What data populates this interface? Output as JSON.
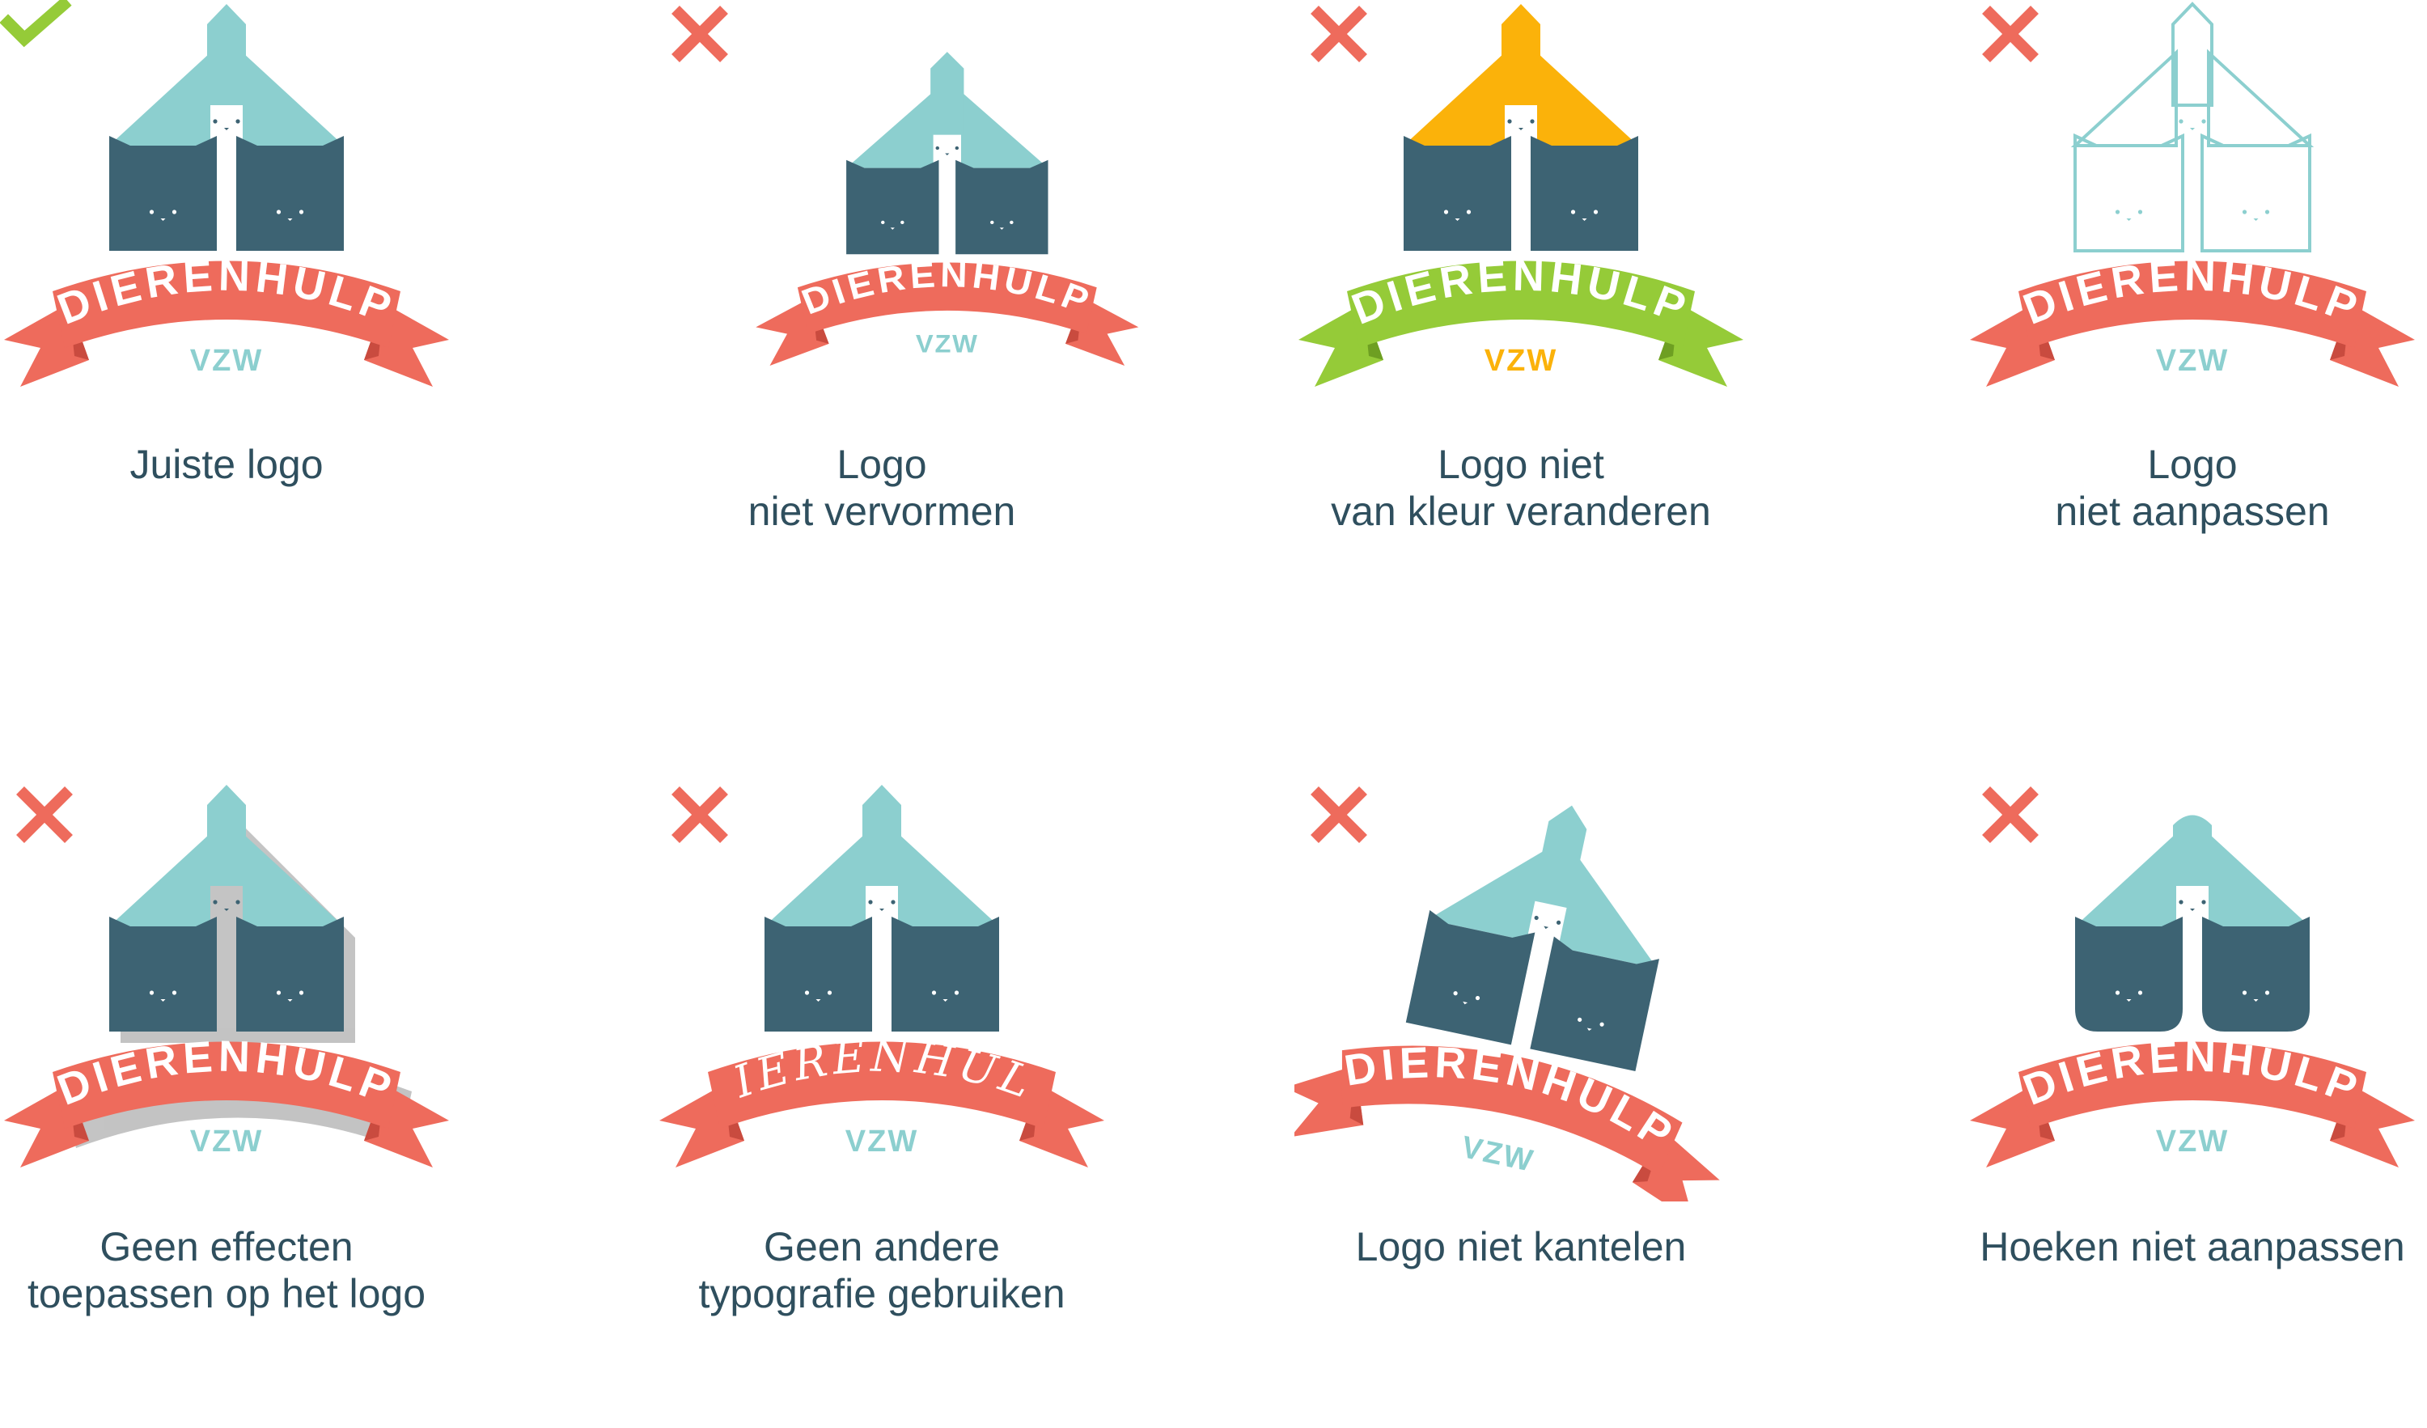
{
  "brand": {
    "name": "DIERENHULP",
    "sub": "VZW"
  },
  "colors": {
    "teal": "#8ccfcf",
    "navy": "#3d6373",
    "coral": "#ee6b5c",
    "coral_dark": "#c94b3f",
    "green": "#95cb38",
    "orange": "#fbb20a",
    "check": "#95cb38",
    "cross": "#ee6b5c",
    "caption": "#2f4f5e"
  },
  "items": [
    {
      "status": "check",
      "variant": "correct",
      "caption": [
        "Juiste logo"
      ]
    },
    {
      "status": "cross",
      "variant": "distorted",
      "caption": [
        "Logo",
        "niet vervormen"
      ]
    },
    {
      "status": "cross",
      "variant": "recolor",
      "caption": [
        "Logo niet",
        "van kleur veranderen"
      ]
    },
    {
      "status": "cross",
      "variant": "outline",
      "caption": [
        "Logo",
        "niet aanpassen"
      ]
    },
    {
      "status": "cross",
      "variant": "shadow",
      "caption": [
        "Geen effecten",
        "toepassen op het logo"
      ]
    },
    {
      "status": "cross",
      "variant": "font",
      "caption": [
        "Geen andere",
        "typografie gebruiken"
      ]
    },
    {
      "status": "cross",
      "variant": "tilt",
      "caption": [
        "Logo niet kantelen"
      ]
    },
    {
      "status": "cross",
      "variant": "rounded",
      "caption": [
        "Hoeken niet aanpassen"
      ]
    }
  ]
}
